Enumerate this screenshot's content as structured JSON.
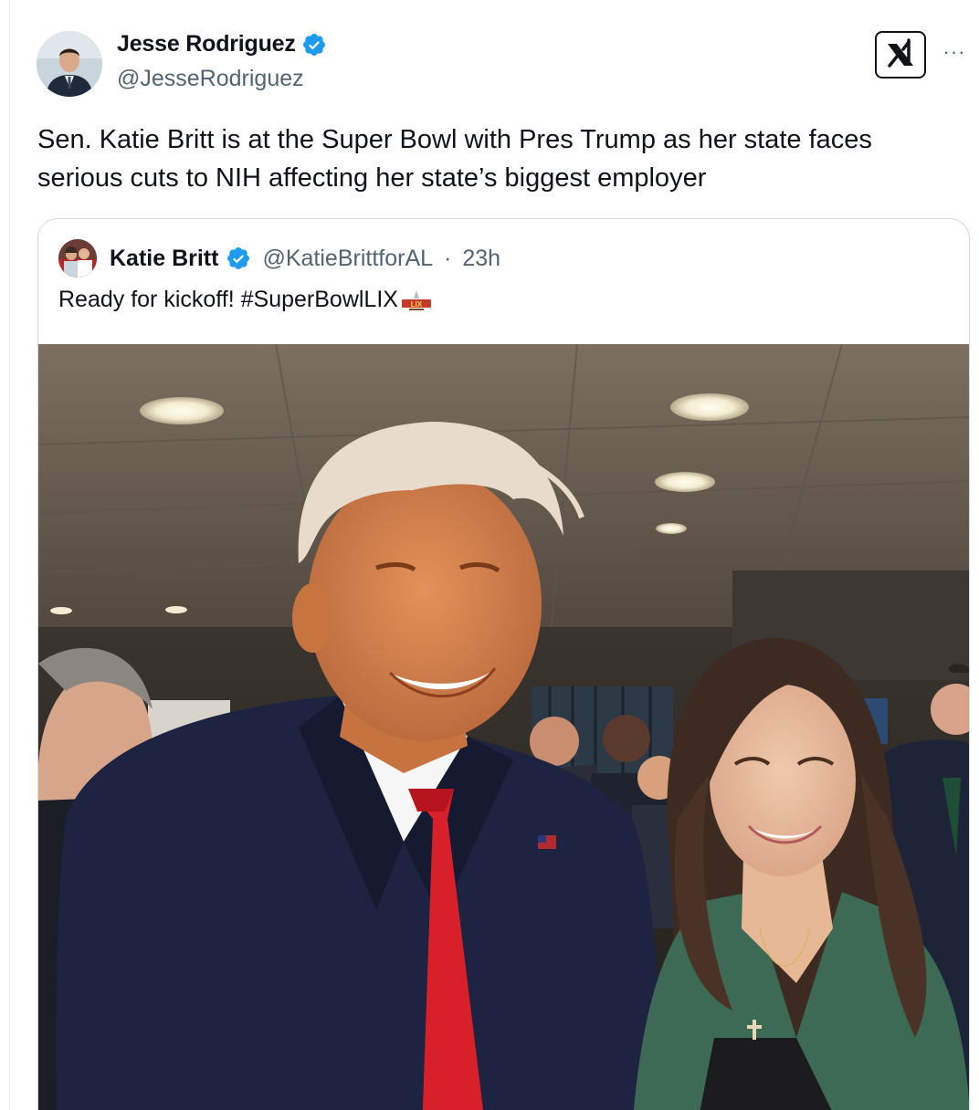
{
  "tweet": {
    "author": {
      "name": "Jesse Rodriguez",
      "handle": "@JesseRodriguez",
      "avatar_icon": "profile-photo",
      "verified_icon": "verified-badge-icon"
    },
    "actions": {
      "grok_icon": "grok-icon",
      "more_label": "···"
    },
    "text": "Sen. Katie Britt is at the Super Bowl with Pres Trump as her state faces serious cuts to NIH affecting her state’s biggest employer"
  },
  "quote": {
    "author": {
      "name": "Katie Britt",
      "handle": "@KatieBrittforAL",
      "separator": "·",
      "time": "23h",
      "verified_icon": "verified-badge-icon"
    },
    "text": "Ready for kickoff! #SuperBowlLIX",
    "emoji_icon": "super-bowl-lix-logo-icon",
    "photo_icon": "photo-of-two-people-at-event"
  },
  "colors": {
    "text_primary": "#0f1419",
    "text_secondary": "#536471",
    "verified_blue": "#1d9bf0",
    "border": "#cfd9de"
  }
}
